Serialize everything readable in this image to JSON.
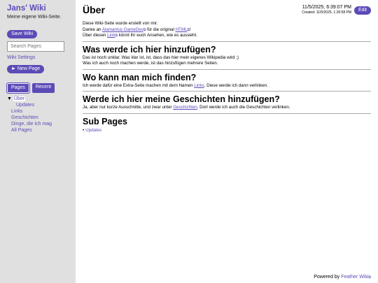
{
  "sidebar": {
    "wiki_title": "Jans' Wiki",
    "wiki_description": "Meine eigene Wiki-Seite.",
    "save_button": "Save Wiki",
    "search_placeholder": "Search Pages",
    "settings_link": "Wiki Settings",
    "new_page_button": "► New Page",
    "tabs": [
      {
        "label": "Pages",
        "active": true
      },
      {
        "label": "Recent",
        "active": false
      }
    ],
    "pages": {
      "current_marker": "▼",
      "current": "Über",
      "child": "Updates",
      "others": [
        "Links",
        "Geschichten",
        "Dinge, die ich mag",
        "All Pages"
      ]
    }
  },
  "header": {
    "title": "Über",
    "updated": "11/5/2025, 6:39:07 PM",
    "created": "Created: 11/5/2025, 1:26:58 PM",
    "edit_button": "Edit"
  },
  "content": {
    "intro_line1": "Diese Wiki-Seite wurde erstellt von mir.",
    "intro_line2": {
      "before": "Danke an ",
      "link1": "Alamantus GameDev",
      "middle": " für die original ",
      "link2": "HTML",
      "after": "!"
    },
    "intro_line3": {
      "before": "Über diesen ",
      "link": "Link",
      "after": " könnt ihr euch Ansehen, wie es aussieht."
    },
    "section1": {
      "heading": "Was werde ich hier hinzufügen?",
      "line1": "Das ist noch unklar. Was klar ist, ist, dass das hier mein eigenes Wikipedia wird ;)",
      "line2": "Was ich auch noch machen werde, ist das hinzufügen mehrere Seiten."
    },
    "section2": {
      "heading": "Wo kann man mich finden?",
      "before": "Ich werde dafür eine Extra-Seite machen mit dem Namen ",
      "link": "Links",
      "after": ". Diese werde ich dann verlinken."
    },
    "section3": {
      "heading": "Werde ich hier meine Geschichten hinzufügen?",
      "before": "Ja, aber nur kurze Ausschnitte, und zwar unter ",
      "link": "Geschichten",
      "after": ". Dort werde ich auch die Geschichten verlinken."
    },
    "subpages": {
      "heading": "Sub Pages",
      "items": [
        "Updates"
      ]
    }
  },
  "footer": {
    "text": "Powered by ",
    "link": "Feather Wiki"
  },
  "colors": {
    "accent": "#5b4bb7",
    "sidebar_bg": "#e0e0e0"
  },
  "icons": {
    "external_link": "external-link-icon",
    "current_page_marker": "triangle-down-icon"
  }
}
